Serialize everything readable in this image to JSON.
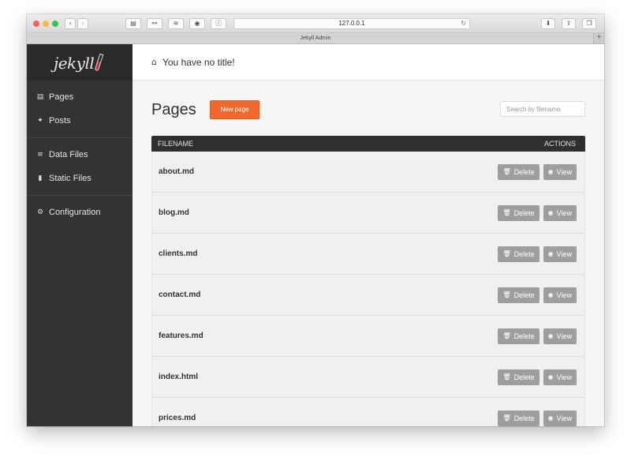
{
  "browser": {
    "url": "127.0.0.1",
    "tab_title": "Jekyll Admin",
    "tab_new": "+"
  },
  "sidebar": {
    "logo": "jekyll",
    "groups": [
      [
        {
          "label": "Pages",
          "icon": "file-icon"
        },
        {
          "label": "Posts",
          "icon": "pin-icon"
        }
      ],
      [
        {
          "label": "Data Files",
          "icon": "database-icon"
        },
        {
          "label": "Static Files",
          "icon": "file-icon"
        }
      ],
      [
        {
          "label": "Configuration",
          "icon": "gear-icon"
        }
      ]
    ]
  },
  "header": {
    "title": "You have no title!"
  },
  "main": {
    "heading": "Pages",
    "new_button": "New page",
    "search_placeholder": "Search by filename",
    "table": {
      "col_filename": "FILENAME",
      "col_actions": "ACTIONS",
      "delete_label": "Delete",
      "view_label": "View",
      "rows": [
        "about.md",
        "blog.md",
        "clients.md",
        "contact.md",
        "features.md",
        "index.html",
        "prices.md"
      ]
    }
  },
  "colors": {
    "accent": "#f2672a",
    "sidebar": "#333333",
    "button_gray": "#9e9e9e"
  }
}
